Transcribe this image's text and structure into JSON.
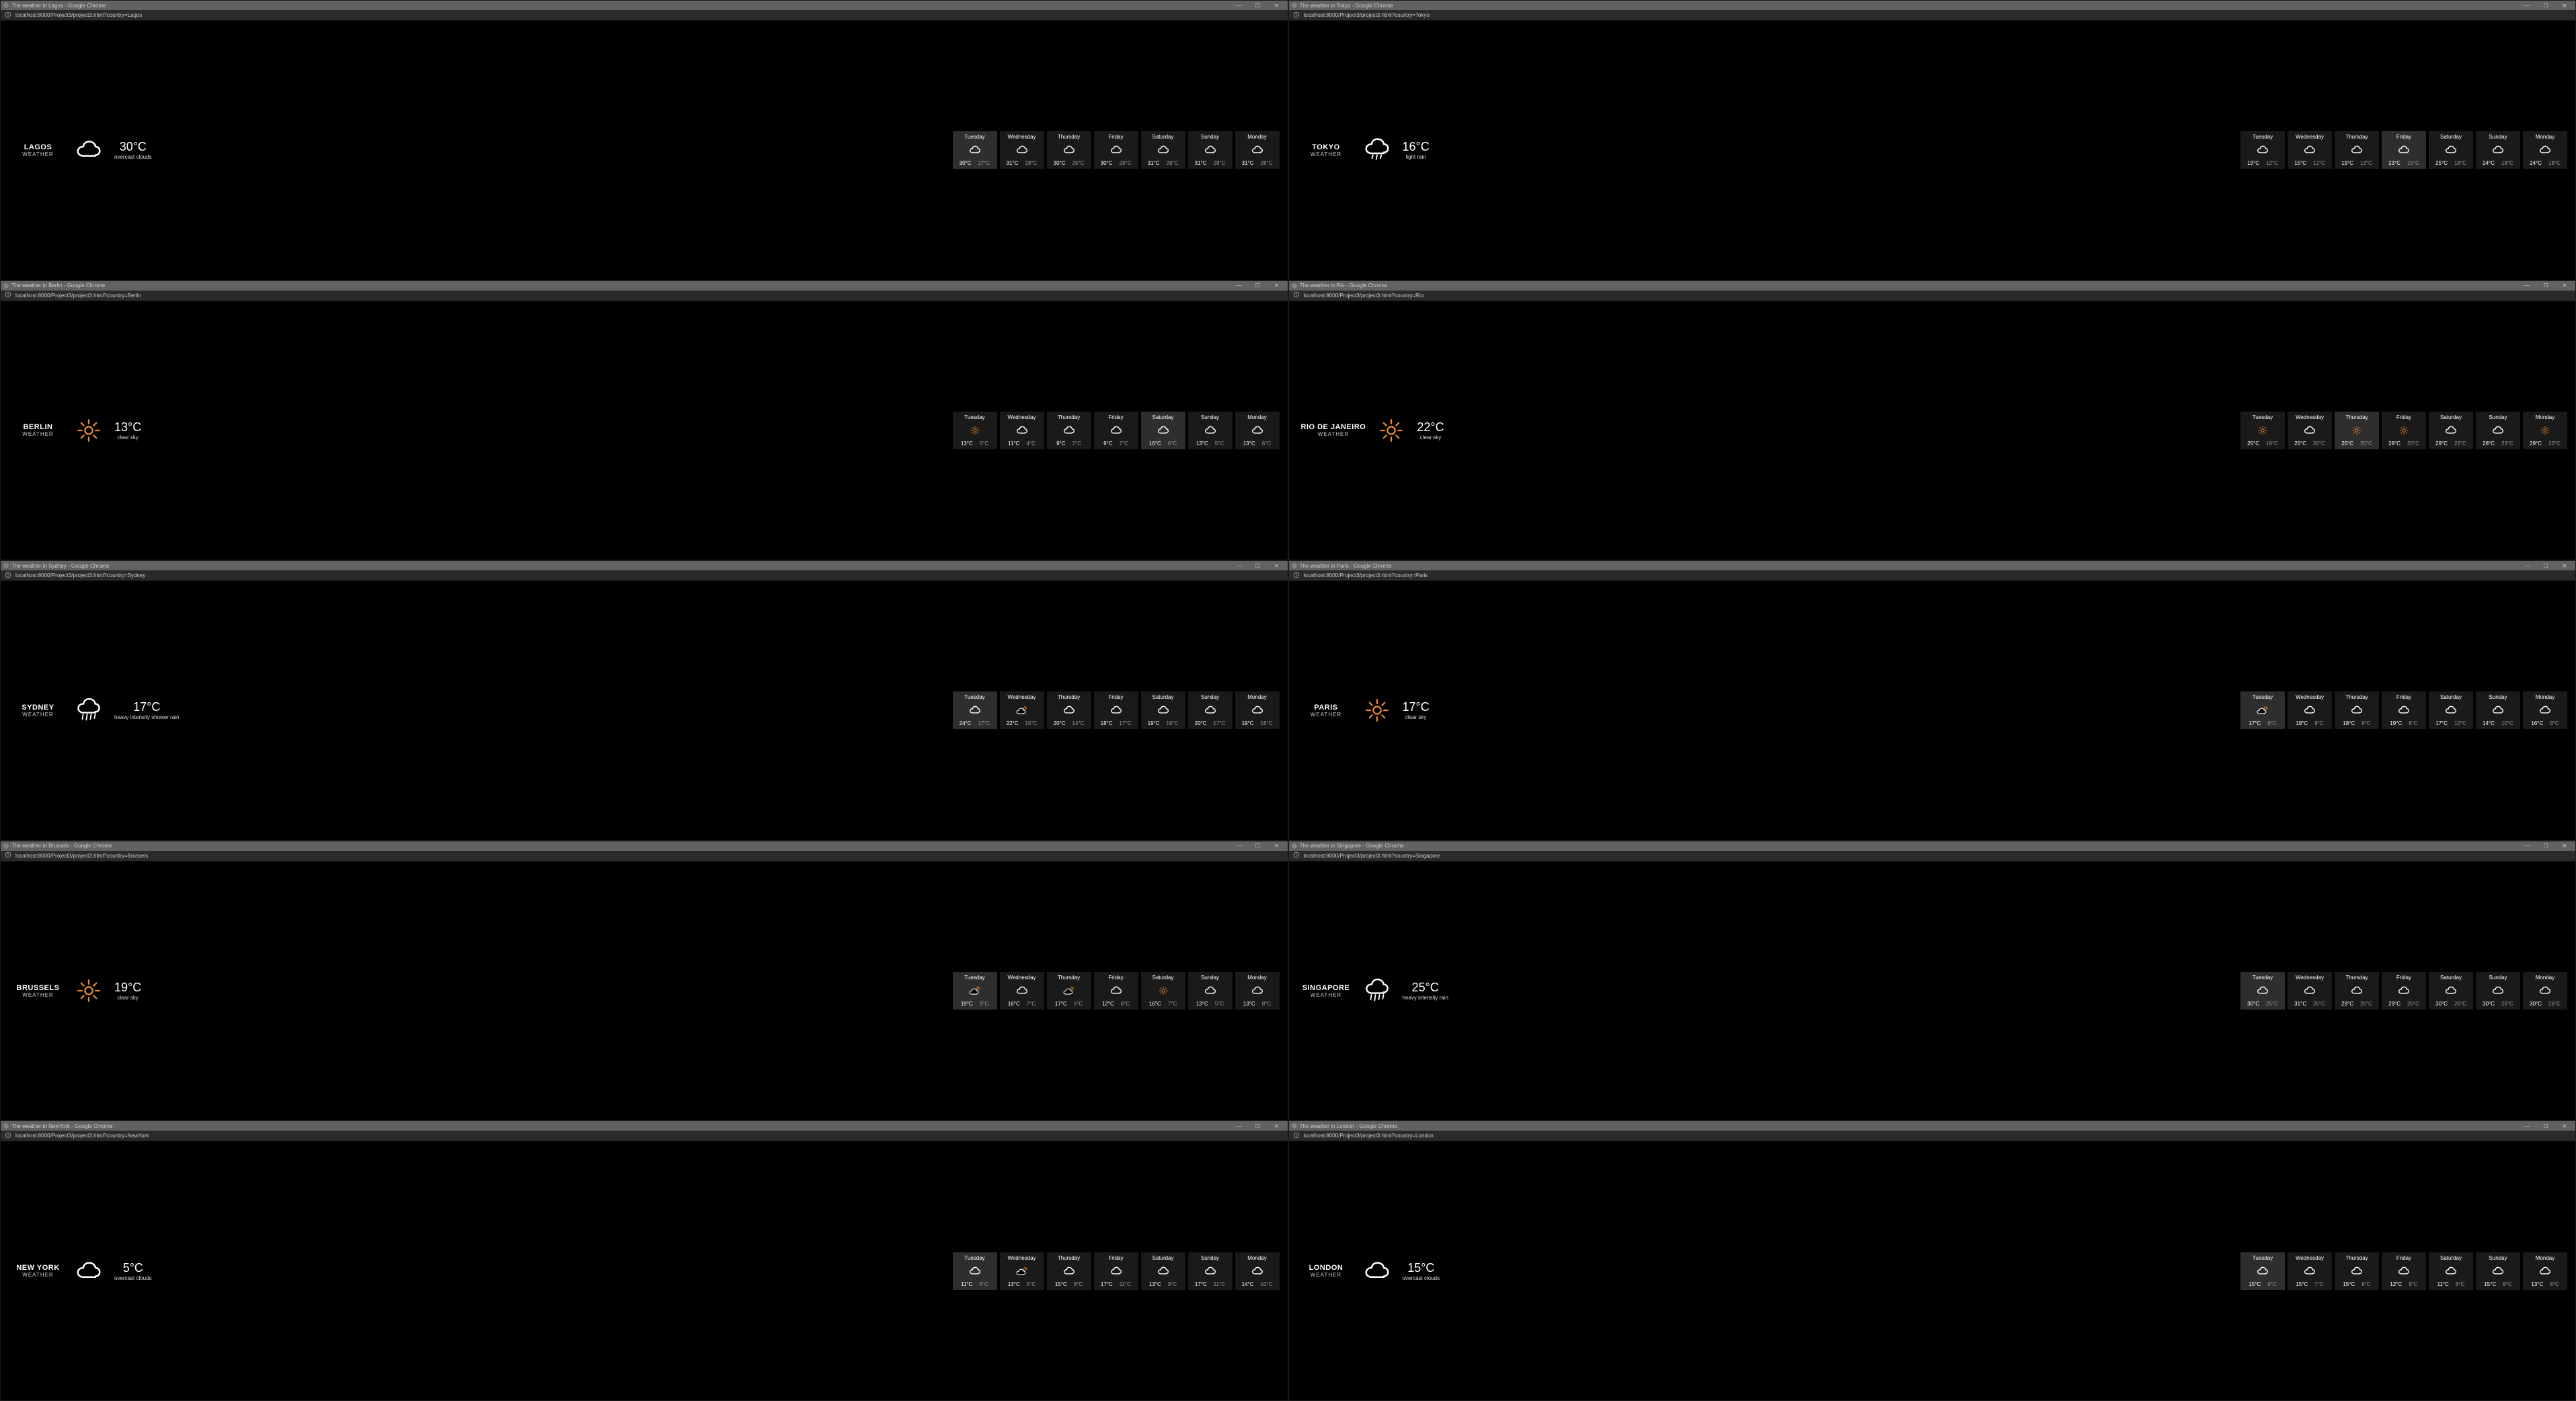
{
  "days": [
    "Tuesday",
    "Wednesday",
    "Thursday",
    "Friday",
    "Saturday",
    "Sunday",
    "Monday"
  ],
  "selected": [
    0,
    3,
    4,
    2,
    0,
    0,
    0,
    0,
    0,
    0
  ],
  "windows": [
    {
      "title": "The weather in Lagos - Google Chrome",
      "url": "localhost:8000/Project3/project3.html?country=Lagos",
      "city": "LAGOS",
      "label": "WEATHER",
      "icon": "cloud",
      "temp": "30°C",
      "cond": "overcast clouds",
      "forecast": [
        {
          "i": "cloud",
          "hi": "30°C",
          "lo": "27°C"
        },
        {
          "i": "cloud",
          "hi": "31°C",
          "lo": "28°C"
        },
        {
          "i": "cloud",
          "hi": "30°C",
          "lo": "25°C"
        },
        {
          "i": "cloud",
          "hi": "30°C",
          "lo": "28°C"
        },
        {
          "i": "cloud",
          "hi": "31°C",
          "lo": "28°C"
        },
        {
          "i": "cloud",
          "hi": "31°C",
          "lo": "28°C"
        },
        {
          "i": "cloud",
          "hi": "31°C",
          "lo": "28°C"
        }
      ]
    },
    {
      "title": "The weather in Tokyo - Google Chrome",
      "url": "localhost:8000/Project3/project3.html?country=Tokyo",
      "city": "TOKYO",
      "label": "WEATHER",
      "icon": "rain",
      "temp": "16°C",
      "cond": "light rain",
      "forecast": [
        {
          "i": "cloud",
          "hi": "19°C",
          "lo": "12°C"
        },
        {
          "i": "cloud",
          "hi": "15°C",
          "lo": "12°C"
        },
        {
          "i": "cloud",
          "hi": "19°C",
          "lo": "13°C"
        },
        {
          "i": "cloud",
          "hi": "23°C",
          "lo": "15°C"
        },
        {
          "i": "cloud",
          "hi": "25°C",
          "lo": "18°C"
        },
        {
          "i": "cloud",
          "hi": "24°C",
          "lo": "18°C"
        },
        {
          "i": "cloud",
          "hi": "24°C",
          "lo": "18°C"
        }
      ]
    },
    {
      "title": "The weather in Berlin - Google Chrome",
      "url": "localhost:8000/Project3/project3.html?country=Berlin",
      "city": "BERLIN",
      "label": "WEATHER",
      "icon": "sun",
      "temp": "13°C",
      "cond": "clear sky",
      "forecast": [
        {
          "i": "sun",
          "hi": "13°C",
          "lo": "5°C"
        },
        {
          "i": "cloud",
          "hi": "11°C",
          "lo": "4°C"
        },
        {
          "i": "cloud",
          "hi": "9°C",
          "lo": "7°C"
        },
        {
          "i": "cloud",
          "hi": "9°C",
          "lo": "7°C"
        },
        {
          "i": "cloud",
          "hi": "16°C",
          "lo": "6°C"
        },
        {
          "i": "cloud",
          "hi": "13°C",
          "lo": "5°C"
        },
        {
          "i": "cloud",
          "hi": "13°C",
          "lo": "6°C"
        }
      ]
    },
    {
      "title": "The weather in Rio - Google Chrome",
      "url": "localhost:8000/Project3/project3.html?country=Rio",
      "city": "RIO DE JANEIRO",
      "label": "WEATHER",
      "icon": "sun",
      "temp": "22°C",
      "cond": "clear sky",
      "forecast": [
        {
          "i": "sun",
          "hi": "25°C",
          "lo": "19°C"
        },
        {
          "i": "cloud",
          "hi": "25°C",
          "lo": "20°C"
        },
        {
          "i": "sun",
          "hi": "25°C",
          "lo": "20°C"
        },
        {
          "i": "sun",
          "hi": "29°C",
          "lo": "20°C"
        },
        {
          "i": "cloud",
          "hi": "29°C",
          "lo": "22°C"
        },
        {
          "i": "cloud",
          "hi": "28°C",
          "lo": "23°C"
        },
        {
          "i": "sun",
          "hi": "29°C",
          "lo": "22°C"
        }
      ]
    },
    {
      "title": "The weather in Sydney - Google Chrome",
      "url": "localhost:8000/Project3/project3.html?country=Sydney",
      "city": "SYDNEY",
      "label": "WEATHER",
      "icon": "showers",
      "temp": "17°C",
      "cond": "heavy intensity shower rain",
      "forecast": [
        {
          "i": "cloud",
          "hi": "24°C",
          "lo": "17°C"
        },
        {
          "i": "suncloud",
          "hi": "22°C",
          "lo": "15°C"
        },
        {
          "i": "cloud",
          "hi": "20°C",
          "lo": "14°C"
        },
        {
          "i": "cloud",
          "hi": "18°C",
          "lo": "17°C"
        },
        {
          "i": "cloud",
          "hi": "19°C",
          "lo": "16°C"
        },
        {
          "i": "cloud",
          "hi": "20°C",
          "lo": "17°C"
        },
        {
          "i": "cloud",
          "hi": "19°C",
          "lo": "18°C"
        }
      ]
    },
    {
      "title": "The weather in Paris - Google Chrome",
      "url": "localhost:8000/Project3/project3.html?country=Paris",
      "city": "PARIS",
      "label": "WEATHER",
      "icon": "sun",
      "temp": "17°C",
      "cond": "clear sky",
      "forecast": [
        {
          "i": "suncloud",
          "hi": "17°C",
          "lo": "9°C"
        },
        {
          "i": "cloud",
          "hi": "18°C",
          "lo": "9°C"
        },
        {
          "i": "cloud",
          "hi": "18°C",
          "lo": "8°C"
        },
        {
          "i": "cloud",
          "hi": "19°C",
          "lo": "8°C"
        },
        {
          "i": "cloud",
          "hi": "17°C",
          "lo": "12°C"
        },
        {
          "i": "cloud",
          "hi": "14°C",
          "lo": "10°C"
        },
        {
          "i": "cloud",
          "hi": "16°C",
          "lo": "9°C"
        }
      ]
    },
    {
      "title": "The weather in Brussels - Google Chrome",
      "url": "localhost:8000/Project3/project3.html?country=Brussels",
      "city": "BRUSSELS",
      "label": "WEATHER",
      "icon": "sun",
      "temp": "19°C",
      "cond": "clear sky",
      "forecast": [
        {
          "i": "suncloud",
          "hi": "19°C",
          "lo": "9°C"
        },
        {
          "i": "cloud",
          "hi": "16°C",
          "lo": "7°C"
        },
        {
          "i": "suncloud",
          "hi": "17°C",
          "lo": "6°C"
        },
        {
          "i": "cloud",
          "hi": "12°C",
          "lo": "6°C"
        },
        {
          "i": "sun",
          "hi": "16°C",
          "lo": "7°C"
        },
        {
          "i": "cloud",
          "hi": "13°C",
          "lo": "5°C"
        },
        {
          "i": "cloud",
          "hi": "13°C",
          "lo": "8°C"
        }
      ]
    },
    {
      "title": "The weather in Singapore - Google Chrome",
      "url": "localhost:8000/Project3/project3.html?country=Singapore",
      "city": "SINGAPORE",
      "label": "WEATHER",
      "icon": "showers",
      "temp": "25°C",
      "cond": "heavy intensity rain",
      "forecast": [
        {
          "i": "cloud",
          "hi": "30°C",
          "lo": "25°C"
        },
        {
          "i": "cloud",
          "hi": "31°C",
          "lo": "26°C"
        },
        {
          "i": "cloud",
          "hi": "29°C",
          "lo": "26°C"
        },
        {
          "i": "cloud",
          "hi": "29°C",
          "lo": "26°C"
        },
        {
          "i": "cloud",
          "hi": "30°C",
          "lo": "26°C"
        },
        {
          "i": "cloud",
          "hi": "30°C",
          "lo": "26°C"
        },
        {
          "i": "cloud",
          "hi": "30°C",
          "lo": "26°C"
        }
      ]
    },
    {
      "title": "The weather in NewYork - Google Chrome",
      "url": "localhost:8000/Project3/project3.html?country=NewYork",
      "city": "NEW YORK",
      "label": "WEATHER",
      "icon": "cloud",
      "temp": "5°C",
      "cond": "overcast clouds",
      "forecast": [
        {
          "i": "cloud",
          "hi": "11°C",
          "lo": "5°C"
        },
        {
          "i": "suncloud",
          "hi": "13°C",
          "lo": "5°C"
        },
        {
          "i": "cloud",
          "hi": "15°C",
          "lo": "8°C"
        },
        {
          "i": "cloud",
          "hi": "17°C",
          "lo": "11°C"
        },
        {
          "i": "cloud",
          "hi": "13°C",
          "lo": "9°C"
        },
        {
          "i": "cloud",
          "hi": "17°C",
          "lo": "11°C"
        },
        {
          "i": "cloud",
          "hi": "14°C",
          "lo": "10°C"
        }
      ]
    },
    {
      "title": "The weather in London - Google Chrome",
      "url": "localhost:8000/Project3/project3.html?country=London",
      "city": "LONDON",
      "label": "WEATHER",
      "icon": "cloud",
      "temp": "15°C",
      "cond": "overcast clouds",
      "forecast": [
        {
          "i": "cloud",
          "hi": "15°C",
          "lo": "9°C"
        },
        {
          "i": "cloud",
          "hi": "15°C",
          "lo": "7°C"
        },
        {
          "i": "cloud",
          "hi": "15°C",
          "lo": "8°C"
        },
        {
          "i": "cloud",
          "hi": "12°C",
          "lo": "9°C"
        },
        {
          "i": "cloud",
          "hi": "11°C",
          "lo": "8°C"
        },
        {
          "i": "cloud",
          "hi": "15°C",
          "lo": "8°C"
        },
        {
          "i": "cloud",
          "hi": "13°C",
          "lo": "6°C"
        }
      ]
    }
  ]
}
